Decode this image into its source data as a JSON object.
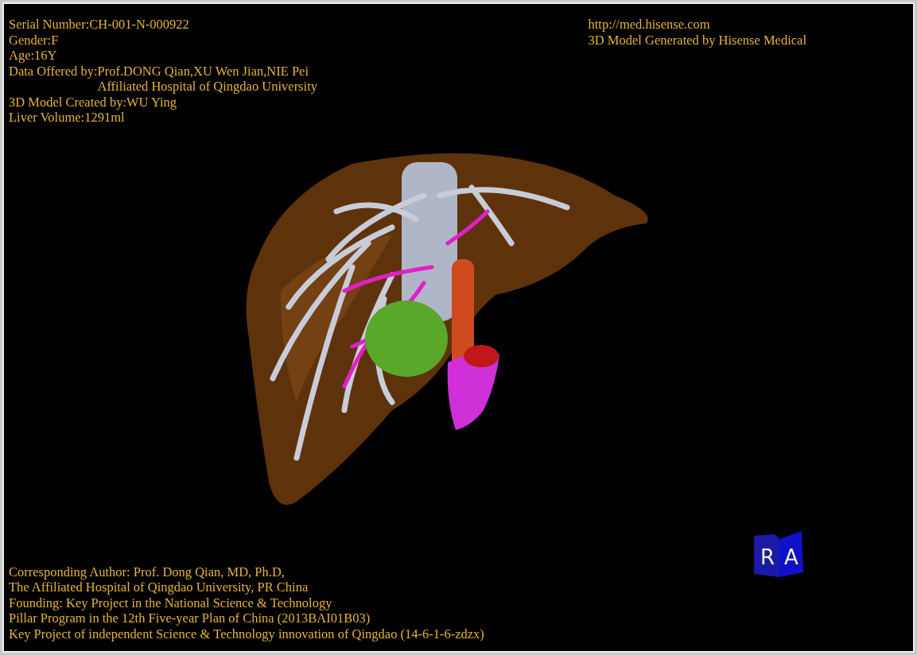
{
  "header_left": {
    "lines": [
      "Serial Number:CH-001-N-000922",
      "Gender:F",
      "Age:16Y"
    ],
    "data_offered": {
      "label": "Data Offered by:",
      "lines": [
        "Prof.DONG Qian,XU Wen Jian,NIE Pei",
        "Affiliated Hospital of Qingdao University"
      ]
    },
    "more_lines": [
      "3D Model Created by:WU Ying",
      "Liver Volume:1291ml"
    ]
  },
  "header_right": {
    "link": "http://med.hisense.com",
    "caption": "3D Model Generated by Hisense Medical"
  },
  "orientation_cube": {
    "faces": [
      "R",
      "A"
    ]
  },
  "footer": [
    "Corresponding Author: Prof. Dong Qian, MD, Ph.D,",
    "The Affiliated Hospital of Qingdao University, PR China",
    "Founding: Key Project in the National Science & Technology",
    "Pillar Program in the 12th Five-year Plan of China (2013BAI01B03)",
    "Key Project of independent Science & Technology innovation of Qingdao (14-6-1-6-zdzx)"
  ]
}
